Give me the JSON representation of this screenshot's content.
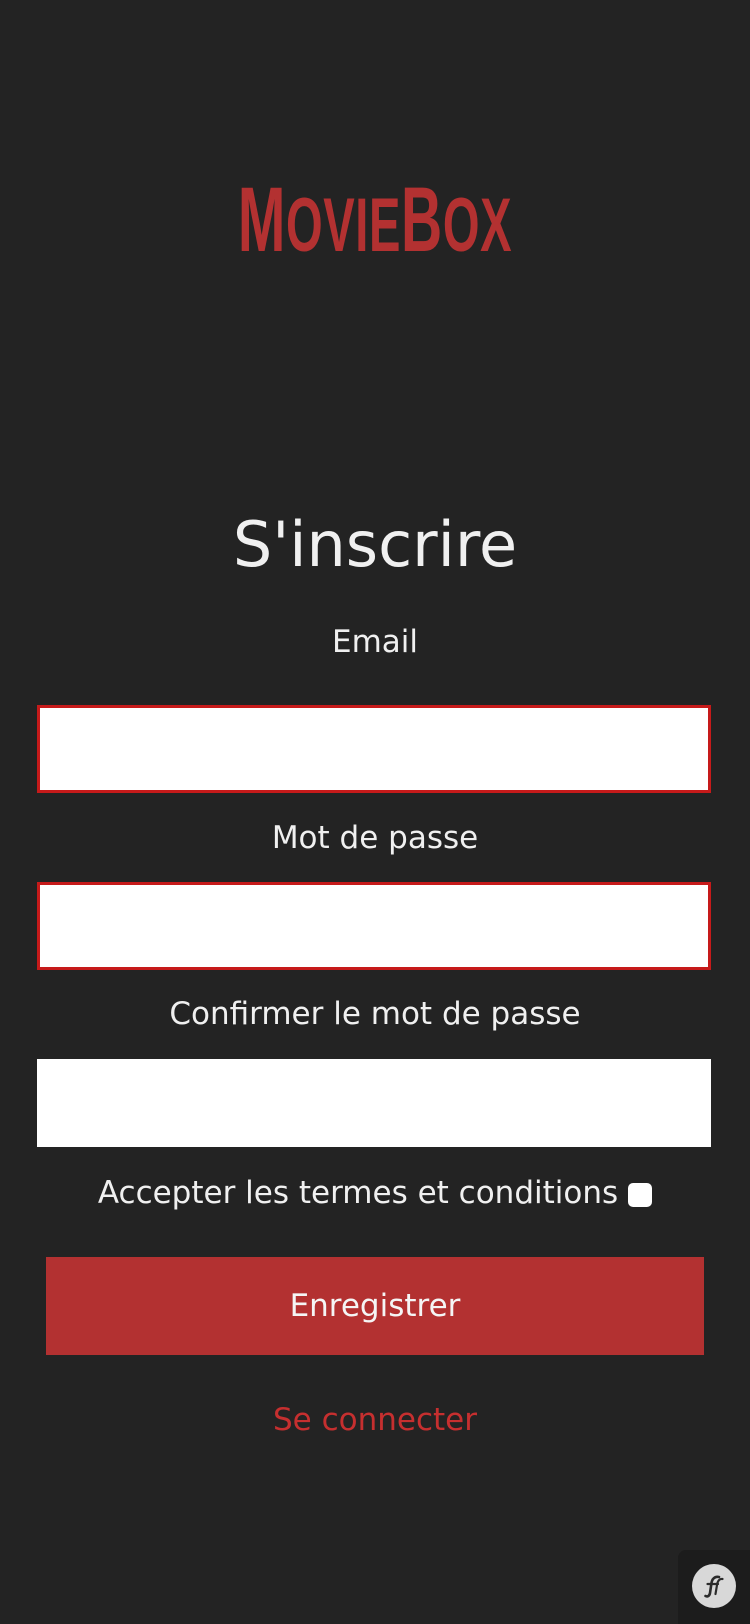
{
  "header": {
    "logo_first": "M",
    "logo_rest1": "OVIE",
    "logo_second": "B",
    "logo_rest2": "OX"
  },
  "form": {
    "title": "S'inscrire",
    "email_label": "Email",
    "email_value": "",
    "password_label": "Mot de passe",
    "password_value": "",
    "confirm_label": "Confirmer le mot de passe",
    "confirm_value": "",
    "terms_label": "Accepter les termes et conditions",
    "terms_checked": false,
    "submit_label": "Enregistrer",
    "login_link": "Se connecter"
  },
  "colors": {
    "background": "#232323",
    "accent": "#b33131",
    "error_border": "#c61a1a",
    "text": "#f0f0f0"
  },
  "toolbar": {
    "icon": "symfony-icon"
  }
}
